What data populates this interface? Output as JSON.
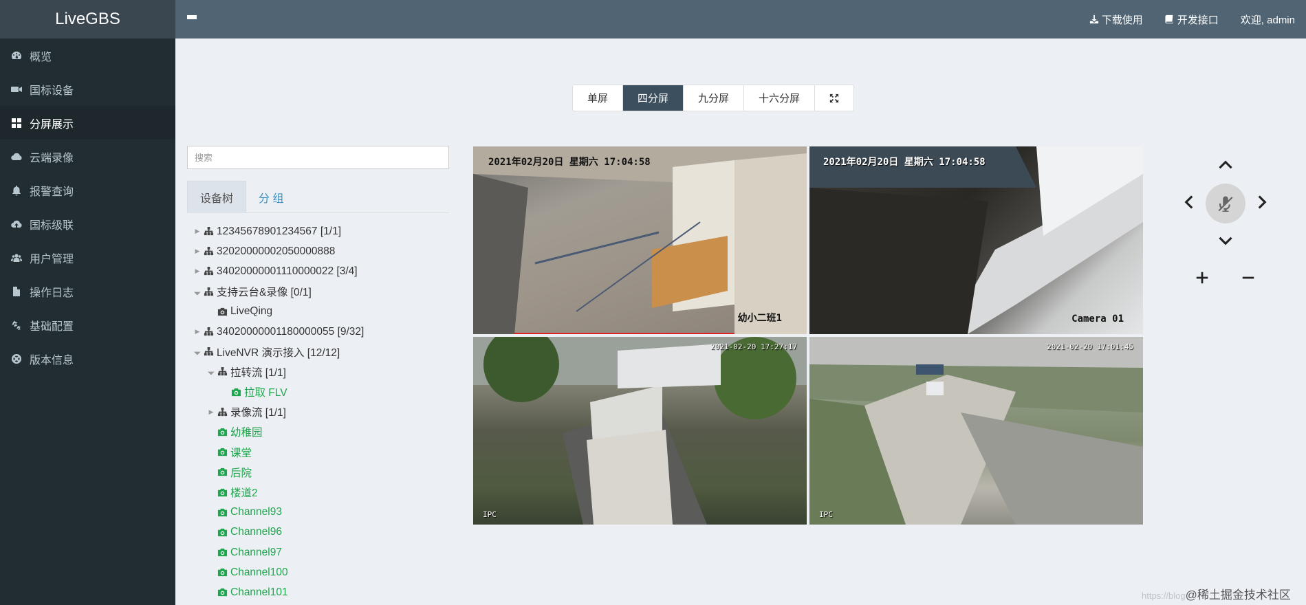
{
  "app": {
    "title": "LiveGBS"
  },
  "sidebar": {
    "items": [
      {
        "label": "概览",
        "icon": "dashboard-icon"
      },
      {
        "label": "国标设备",
        "icon": "video-camera-icon"
      },
      {
        "label": "分屏展示",
        "icon": "grid-icon",
        "active": true
      },
      {
        "label": "云端录像",
        "icon": "cloud-icon"
      },
      {
        "label": "报警查询",
        "icon": "bell-icon"
      },
      {
        "label": "国标级联",
        "icon": "cloud-upload-icon"
      },
      {
        "label": "用户管理",
        "icon": "users-icon"
      },
      {
        "label": "操作日志",
        "icon": "file-icon"
      },
      {
        "label": "基础配置",
        "icon": "gears-icon"
      },
      {
        "label": "版本信息",
        "icon": "lifebuoy-icon"
      }
    ]
  },
  "header": {
    "download_label": "下载使用",
    "api_label": "开发接口",
    "welcome_label": "欢迎, admin"
  },
  "views": {
    "single": "单屏",
    "four": "四分屏",
    "nine": "九分屏",
    "sixteen": "十六分屏",
    "active": "四分屏"
  },
  "search": {
    "placeholder": "搜索"
  },
  "tabs": {
    "device_tree": "设备树",
    "group": "分 组"
  },
  "tree": [
    {
      "label": "12345678901234567 [1/1]",
      "level": 0,
      "type": "folder",
      "expanded": false
    },
    {
      "label": "32020000002050000888",
      "level": 0,
      "type": "folder",
      "expanded": false
    },
    {
      "label": "34020000001110000022 [3/4]",
      "level": 0,
      "type": "folder",
      "expanded": false
    },
    {
      "label": "支持云台&录像 [0/1]",
      "level": 0,
      "type": "folder",
      "expanded": true
    },
    {
      "label": "LiveQing",
      "level": 1,
      "type": "camera-offline"
    },
    {
      "label": "34020000001180000055 [9/32]",
      "level": 0,
      "type": "folder",
      "expanded": false
    },
    {
      "label": "LiveNVR 演示接入 [12/12]",
      "level": 0,
      "type": "folder",
      "expanded": true
    },
    {
      "label": "拉转流 [1/1]",
      "level": 1,
      "type": "folder",
      "expanded": true
    },
    {
      "label": "拉取 FLV",
      "level": 2,
      "type": "camera-online"
    },
    {
      "label": "录像流 [1/1]",
      "level": 1,
      "type": "folder",
      "expanded": false
    },
    {
      "label": "幼稚园",
      "level": 1,
      "type": "camera-online"
    },
    {
      "label": "课堂",
      "level": 1,
      "type": "camera-online"
    },
    {
      "label": "后院",
      "level": 1,
      "type": "camera-online"
    },
    {
      "label": "楼道2",
      "level": 1,
      "type": "camera-online"
    },
    {
      "label": "Channel93",
      "level": 1,
      "type": "camera-online"
    },
    {
      "label": "Channel96",
      "level": 1,
      "type": "camera-online"
    },
    {
      "label": "Channel97",
      "level": 1,
      "type": "camera-online"
    },
    {
      "label": "Channel100",
      "level": 1,
      "type": "camera-online"
    },
    {
      "label": "Channel101",
      "level": 1,
      "type": "camera-online"
    }
  ],
  "videos": [
    {
      "osd_top": "2021年02月20日  星期六  17:04:58",
      "osd_bottom": "幼小二班1",
      "selected": true
    },
    {
      "osd_top": "2021年02月20日  星期六  17:04:58",
      "osd_bottom": "Camera 01",
      "selected": false
    },
    {
      "osd_top": "2021-02-20 17:27:17",
      "osd_bottom": "IPC",
      "selected": false
    },
    {
      "osd_top": "2021-02-20 17:01:45",
      "osd_bottom": "IPC",
      "selected": false
    }
  ],
  "ptz": {
    "up": "chevron-up-icon",
    "down": "chevron-down-icon",
    "left": "chevron-left-icon",
    "right": "chevron-right-icon",
    "center": "mute-mic-icon",
    "zoom_in": "plus-icon",
    "zoom_out": "minus-icon"
  },
  "watermark": {
    "faint": "https://blog",
    "text": "@稀土掘金技术社区"
  }
}
